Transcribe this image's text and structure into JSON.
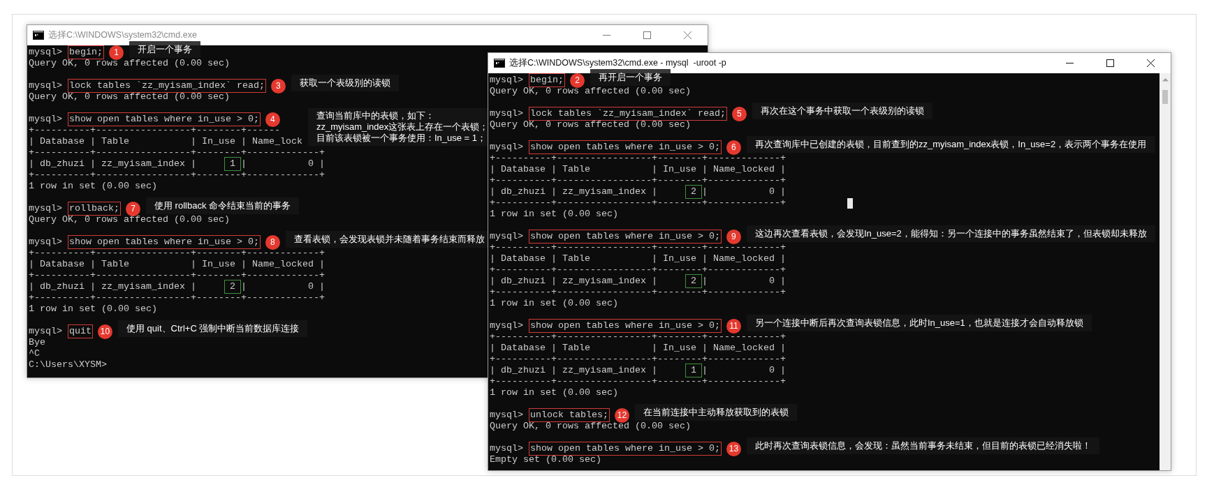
{
  "windows": [
    {
      "title": "选择C:\\WINDOWS\\system32\\cmd.exe",
      "active": false,
      "lines": [
        {
          "kind": "prompt",
          "prompt": "mysql>",
          "command": "begin;",
          "badge": "1",
          "note": [
            "开启一个事务"
          ]
        },
        {
          "kind": "text",
          "text": "Query OK, 0 rows affected (0.00 sec)"
        },
        {
          "kind": "blank"
        },
        {
          "kind": "prompt",
          "prompt": "mysql>",
          "command": "lock tables `zz_myisam_index` read;",
          "badge": "3",
          "note": [
            "获取一个表级别的读锁"
          ]
        },
        {
          "kind": "text",
          "text": "Query OK, 0 rows affected (0.00 sec)"
        },
        {
          "kind": "blank"
        },
        {
          "kind": "prompt",
          "prompt": "mysql>",
          "command": "show open tables where in_use > 0;",
          "badge": "4",
          "note": [
            "查询当前库中的表锁，如下：",
            "zz_myisam_index这张表上存在一个表锁；",
            "目前该表锁被一个事务使用：In_use = 1；"
          ]
        },
        {
          "kind": "text",
          "text": "+----------+-----------------+--------+------"
        },
        {
          "kind": "text",
          "text": "| Database | Table           | In_use | Name_lock"
        },
        {
          "kind": "text",
          "text": "+----------+-----------------+--------+-------------+"
        },
        {
          "kind": "row",
          "text": "| db_zhuzi | zz_myisam_index |",
          "value": "1",
          "rest": "|           0 |"
        },
        {
          "kind": "text",
          "text": "+----------+-----------------+--------+-------------+"
        },
        {
          "kind": "text",
          "text": "1 row in set (0.00 sec)"
        },
        {
          "kind": "blank"
        },
        {
          "kind": "prompt",
          "prompt": "mysql>",
          "command": "rollback;",
          "badge": "7",
          "note": [
            "使用 rollback 命令结束当前的事务"
          ]
        },
        {
          "kind": "text",
          "text": "Query OK, 0 rows affected (0.00 sec)"
        },
        {
          "kind": "blank"
        },
        {
          "kind": "prompt",
          "prompt": "mysql>",
          "command": "show open tables where in_use > 0;",
          "badge": "8",
          "note": [
            "查看表锁，会发现表锁并未随着事务结束而释放"
          ]
        },
        {
          "kind": "text",
          "text": "+----------+-----------------+--------+-------------+"
        },
        {
          "kind": "text",
          "text": "| Database | Table           | In_use | Name_locked |"
        },
        {
          "kind": "text",
          "text": "+----------+-----------------+--------+-------------+"
        },
        {
          "kind": "row",
          "text": "| db_zhuzi | zz_myisam_index |",
          "value": "2",
          "rest": "|           0 |"
        },
        {
          "kind": "text",
          "text": "+----------+-----------------+--------+-------------+"
        },
        {
          "kind": "text",
          "text": "1 row in set (0.00 sec)"
        },
        {
          "kind": "blank"
        },
        {
          "kind": "prompt",
          "prompt": "mysql>",
          "command": "quit",
          "badge": "10",
          "note": [
            "使用 quit、Ctrl+C 强制中断当前数据库连接"
          ]
        },
        {
          "kind": "text",
          "text": "Bye"
        },
        {
          "kind": "text",
          "text": "^C"
        },
        {
          "kind": "text",
          "text": "C:\\Users\\XYSM>"
        }
      ]
    },
    {
      "title": "选择C:\\WINDOWS\\system32\\cmd.exe - mysql  -uroot -p",
      "active": true,
      "scrollbar": true,
      "lines": [
        {
          "kind": "prompt",
          "prompt": "mysql>",
          "command": "begin;",
          "badge": "2",
          "note": [
            "再开启一个事务"
          ]
        },
        {
          "kind": "text",
          "text": "Query OK, 0 rows affected (0.00 sec)"
        },
        {
          "kind": "blank"
        },
        {
          "kind": "prompt",
          "prompt": "mysql>",
          "command": "lock tables `zz_myisam_index` read;",
          "badge": "5",
          "note": [
            "再次在这个事务中获取一个表级别的读锁"
          ]
        },
        {
          "kind": "text",
          "text": "Query OK, 0 rows affected (0.00 sec)"
        },
        {
          "kind": "blank"
        },
        {
          "kind": "prompt",
          "prompt": "mysql>",
          "command": "show open tables where in_use > 0;",
          "badge": "6",
          "note": [
            "再次查询库中已创建的表锁，目前查到的zz_myisam_index表锁，In_use=2，表示两个事务在使用"
          ]
        },
        {
          "kind": "text",
          "text": "+----------+-----------------+--------+-------------+"
        },
        {
          "kind": "text",
          "text": "| Database | Table           | In_use | Name_locked |"
        },
        {
          "kind": "text",
          "text": "+----------+-----------------+--------+-------------+"
        },
        {
          "kind": "row",
          "text": "| db_zhuzi | zz_myisam_index |",
          "value": "2",
          "rest": "|           0 |"
        },
        {
          "kind": "text",
          "text": "+----------+-----------------+--------+-------------+",
          "cursor": true
        },
        {
          "kind": "text",
          "text": "1 row in set (0.00 sec)"
        },
        {
          "kind": "blank"
        },
        {
          "kind": "prompt",
          "prompt": "mysql>",
          "command": "show open tables where in_use > 0;",
          "badge": "9",
          "note": [
            "这边再次查看表锁，会发现In_use=2，能得知：另一个连接中的事务虽然结束了，但表锁却未释放"
          ]
        },
        {
          "kind": "text",
          "text": "+----------+-----------------+--------+-------------+"
        },
        {
          "kind": "text",
          "text": "| Database | Table           | In_use | Name_locked |"
        },
        {
          "kind": "text",
          "text": "+----------+-----------------+--------+-------------+"
        },
        {
          "kind": "row",
          "text": "| db_zhuzi | zz_myisam_index |",
          "value": "2",
          "rest": "|           0 |"
        },
        {
          "kind": "text",
          "text": "+----------+-----------------+--------+-------------+"
        },
        {
          "kind": "text",
          "text": "1 row in set (0.00 sec)"
        },
        {
          "kind": "blank"
        },
        {
          "kind": "prompt",
          "prompt": "mysql>",
          "command": "show open tables where in_use > 0;",
          "badge": "11",
          "note": [
            "另一个连接中断后再次查询表锁信息，此时In_use=1，也就是连接才会自动释放锁"
          ]
        },
        {
          "kind": "text",
          "text": "+----------+-----------------+--------+-------------+"
        },
        {
          "kind": "text",
          "text": "| Database | Table           | In_use | Name_locked |"
        },
        {
          "kind": "text",
          "text": "+----------+-----------------+--------+-------------+"
        },
        {
          "kind": "row",
          "text": "| db_zhuzi | zz_myisam_index |",
          "value": "1",
          "rest": "|           0 |"
        },
        {
          "kind": "text",
          "text": "+----------+-----------------+--------+-------------+"
        },
        {
          "kind": "text",
          "text": "1 row in set (0.00 sec)"
        },
        {
          "kind": "blank"
        },
        {
          "kind": "prompt",
          "prompt": "mysql>",
          "command": "unlock tables;",
          "badge": "12",
          "note": [
            "在当前连接中主动释放获取到的表锁"
          ]
        },
        {
          "kind": "text",
          "text": "Query OK, 0 rows affected (0.00 sec)"
        },
        {
          "kind": "blank"
        },
        {
          "kind": "prompt",
          "prompt": "mysql>",
          "command": "show open tables where in_use > 0;",
          "badge": "13",
          "note": [
            "此时再次查询表锁信息，会发现：虽然当前事务未结束，但目前的表锁已经消失啦！"
          ]
        },
        {
          "kind": "text",
          "text": "Empty set (0.00 sec)"
        }
      ]
    }
  ]
}
